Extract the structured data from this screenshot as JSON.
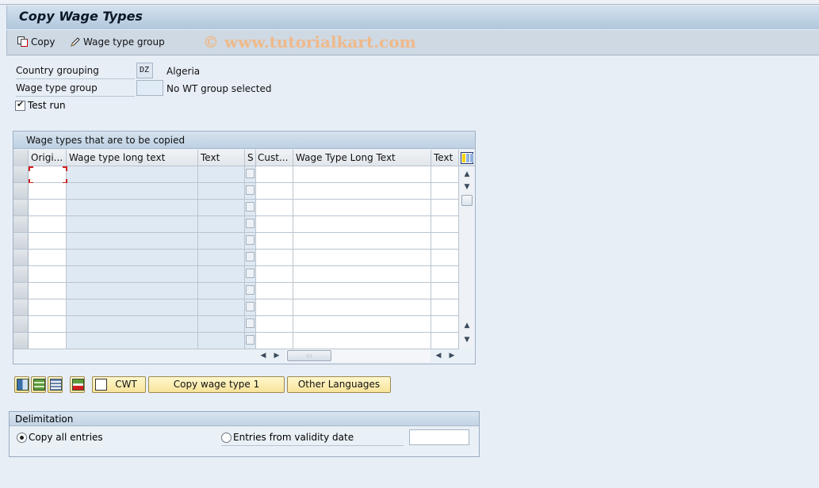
{
  "window": {
    "title": "Copy Wage Types"
  },
  "toolbar": {
    "copy_label": "Copy",
    "wage_type_group_label": "Wage type group",
    "watermark": "© www.tutorialkart.com"
  },
  "selection": {
    "country_grouping_label": "Country grouping",
    "country_grouping_value": "DZ",
    "country_grouping_desc": "Algeria",
    "wage_type_group_label": "Wage type group",
    "wage_type_group_value": "",
    "wage_type_group_desc": "No WT group selected",
    "test_run_label": "Test run",
    "test_run_checked": true
  },
  "table": {
    "title": "Wage types that are to be copied",
    "columns": [
      "Origi...",
      "Wage type long text",
      "Text",
      "S",
      "Cust...",
      "Wage Type Long Text",
      "Text"
    ],
    "row_count": 11,
    "rows": [
      {
        "orig": "",
        "long_text": "",
        "text": "",
        "s": false,
        "cust": "",
        "wt_long_text": "",
        "text2": ""
      },
      {
        "orig": "",
        "long_text": "",
        "text": "",
        "s": false,
        "cust": "",
        "wt_long_text": "",
        "text2": ""
      },
      {
        "orig": "",
        "long_text": "",
        "text": "",
        "s": false,
        "cust": "",
        "wt_long_text": "",
        "text2": ""
      },
      {
        "orig": "",
        "long_text": "",
        "text": "",
        "s": false,
        "cust": "",
        "wt_long_text": "",
        "text2": ""
      },
      {
        "orig": "",
        "long_text": "",
        "text": "",
        "s": false,
        "cust": "",
        "wt_long_text": "",
        "text2": ""
      },
      {
        "orig": "",
        "long_text": "",
        "text": "",
        "s": false,
        "cust": "",
        "wt_long_text": "",
        "text2": ""
      },
      {
        "orig": "",
        "long_text": "",
        "text": "",
        "s": false,
        "cust": "",
        "wt_long_text": "",
        "text2": ""
      },
      {
        "orig": "",
        "long_text": "",
        "text": "",
        "s": false,
        "cust": "",
        "wt_long_text": "",
        "text2": ""
      },
      {
        "orig": "",
        "long_text": "",
        "text": "",
        "s": false,
        "cust": "",
        "wt_long_text": "",
        "text2": ""
      },
      {
        "orig": "",
        "long_text": "",
        "text": "",
        "s": false,
        "cust": "",
        "wt_long_text": "",
        "text2": ""
      },
      {
        "orig": "",
        "long_text": "",
        "text": "",
        "s": false,
        "cust": "",
        "wt_long_text": "",
        "text2": ""
      }
    ]
  },
  "actions": {
    "icon_buttons": [
      "insert-row-icon",
      "select-all-icon",
      "deselect-all-icon",
      "delete-row-icon"
    ],
    "cwt_label": "CWT",
    "copy_wage_type_label": "Copy wage type 1",
    "other_languages_label": "Other Languages"
  },
  "delimitation": {
    "title": "Delimitation",
    "option_all_label": "Copy all entries",
    "option_date_label": "Entries from validity date",
    "selected": "all",
    "date_value": ""
  },
  "colors": {
    "button_yellow": "#f8e39a",
    "focus_red": "#d42020",
    "watermark": "#efb98a"
  }
}
